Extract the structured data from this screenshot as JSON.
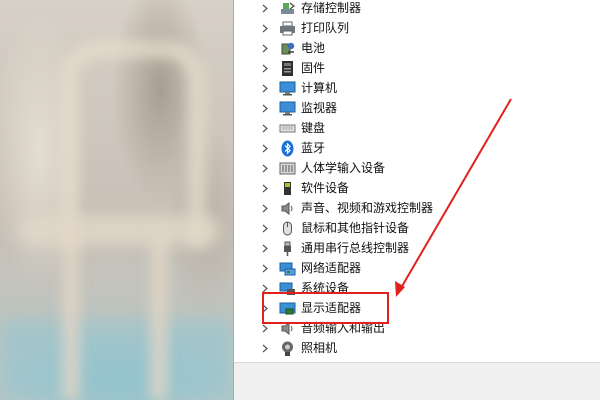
{
  "device_manager": {
    "tree_items": [
      {
        "label": "存储控制器",
        "icon": "storage-controller-icon"
      },
      {
        "label": "打印队列",
        "icon": "printer-icon"
      },
      {
        "label": "电池",
        "icon": "battery-icon"
      },
      {
        "label": "固件",
        "icon": "firmware-icon"
      },
      {
        "label": "计算机",
        "icon": "computer-icon"
      },
      {
        "label": "监视器",
        "icon": "monitor-icon"
      },
      {
        "label": "键盘",
        "icon": "keyboard-icon"
      },
      {
        "label": "蓝牙",
        "icon": "bluetooth-icon"
      },
      {
        "label": "人体学输入设备",
        "icon": "hid-icon"
      },
      {
        "label": "软件设备",
        "icon": "software-device-icon"
      },
      {
        "label": "声音、视频和游戏控制器",
        "icon": "speaker-icon"
      },
      {
        "label": "鼠标和其他指针设备",
        "icon": "mouse-icon"
      },
      {
        "label": "通用串行总线控制器",
        "icon": "usb-icon"
      },
      {
        "label": "网络适配器",
        "icon": "network-adapter-icon"
      },
      {
        "label": "系统设备",
        "icon": "system-device-icon"
      },
      {
        "label": "显示适配器",
        "icon": "display-adapter-icon"
      },
      {
        "label": "音频输入和输出",
        "icon": "audio-io-icon"
      },
      {
        "label": "照相机",
        "icon": "camera-icon"
      }
    ]
  },
  "annotation": {
    "highlighted_item": "显示适配器",
    "highlight_color": "#e0211d"
  }
}
